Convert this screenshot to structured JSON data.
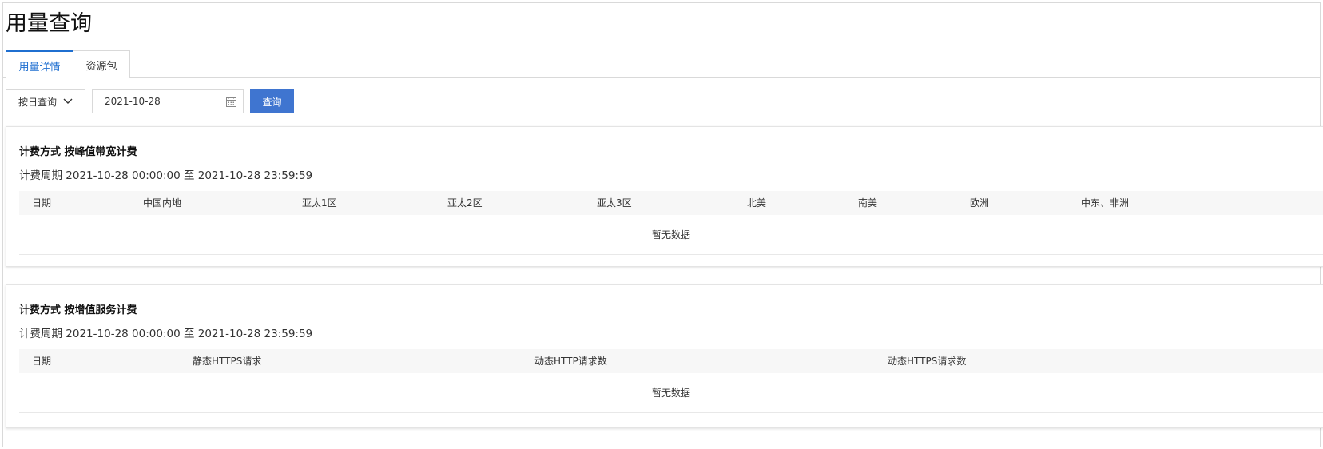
{
  "page": {
    "title": "用量查询"
  },
  "tabs": [
    {
      "label": "用量详情",
      "active": true
    },
    {
      "label": "资源包",
      "active": false
    }
  ],
  "query": {
    "mode": "按日查询",
    "date": "2021-10-28",
    "submit_label": "查询"
  },
  "cards": [
    {
      "title": "计费方式 按峰值带宽计费",
      "period": "计费周期 2021-10-28 00:00:00 至 2021-10-28 23:59:59",
      "columns": [
        "日期",
        "中国内地",
        "亚太1区",
        "亚太2区",
        "亚太3区",
        "北美",
        "南美",
        "欧洲",
        "中东、非洲"
      ],
      "empty_text": "暂无数据"
    },
    {
      "title": "计费方式 按增值服务计费",
      "period": "计费周期 2021-10-28 00:00:00 至 2021-10-28 23:59:59",
      "columns": [
        "日期",
        "静态HTTPS请求",
        "动态HTTP请求数",
        "动态HTTPS请求数"
      ],
      "empty_text": "暂无数据"
    }
  ],
  "colors": {
    "accent": "#1f6fd0",
    "button": "#3f75d0",
    "header_bg": "#f7f7f7",
    "border": "#d9d9d9"
  },
  "icons": {
    "select": "chevron-down-icon",
    "date": "calendar-icon"
  }
}
